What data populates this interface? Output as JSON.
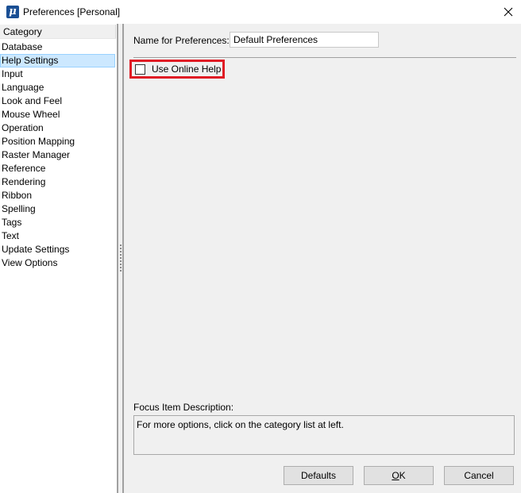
{
  "window": {
    "title": "Preferences [Personal]",
    "app_icon": "microstation-icon",
    "close_icon": "close-icon"
  },
  "category_panel": {
    "header": "Category",
    "selected": "Help Settings",
    "items": [
      {
        "label": "Database"
      },
      {
        "label": "Help Settings"
      },
      {
        "label": "Input"
      },
      {
        "label": "Language"
      },
      {
        "label": "Look and Feel"
      },
      {
        "label": "Mouse Wheel"
      },
      {
        "label": "Operation"
      },
      {
        "label": "Position Mapping"
      },
      {
        "label": "Raster Manager"
      },
      {
        "label": "Reference"
      },
      {
        "label": "Rendering"
      },
      {
        "label": "Ribbon"
      },
      {
        "label": "Spelling"
      },
      {
        "label": "Tags"
      },
      {
        "label": "Text"
      },
      {
        "label": "Update Settings"
      },
      {
        "label": "View Options"
      }
    ]
  },
  "settings": {
    "name_label": "Name for Preferences:",
    "name_value": "Default Preferences",
    "use_online_help": {
      "label": "Use Online Help",
      "checked": false
    },
    "highlight_color": "#e01b24"
  },
  "focus": {
    "label": "Focus Item Description:",
    "text": "For more options, click on the category list at left."
  },
  "buttons": {
    "defaults": "Defaults",
    "ok_mnemonic": "O",
    "ok_rest": "K",
    "cancel": "Cancel"
  }
}
